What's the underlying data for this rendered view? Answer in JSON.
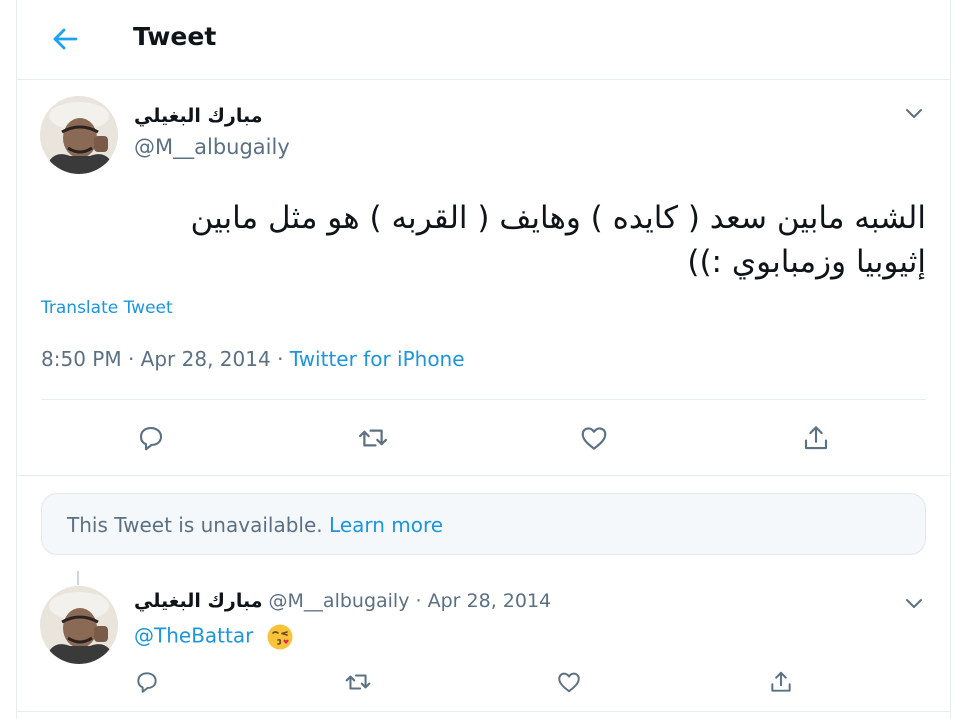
{
  "header": {
    "title": "Tweet",
    "back_icon": "arrow-left-icon"
  },
  "colors": {
    "accent": "#1da1f2",
    "link": "#1b95e0",
    "text": "#0f1419",
    "muted": "#5b7083",
    "border": "#e6ecf0"
  },
  "main_tweet": {
    "author_name": "مبارك البغيلي",
    "author_handle": "@M__albugaily",
    "text_line1": "الشبه مابين سعد ( كايده ) وهايف ( القربه ) هو مثل مابين",
    "text_line2": "إثيوبيا وزمبابوي :))",
    "translate_label": "Translate Tweet",
    "time": "8:50 PM",
    "date": "Apr 28, 2014",
    "source": "Twitter for iPhone",
    "sep": "·",
    "actions": [
      "reply-icon",
      "retweet-icon",
      "like-icon",
      "share-icon"
    ]
  },
  "unavailable": {
    "text": "This Tweet is unavailable.",
    "link": "Learn more"
  },
  "reply_tweet": {
    "author_name": "مبارك البغيلي",
    "author_handle": "@M__albugaily",
    "sep": "·",
    "date": "Apr 28, 2014",
    "mention": "@TheBattar",
    "emoji": "kissing-face-emoji"
  }
}
